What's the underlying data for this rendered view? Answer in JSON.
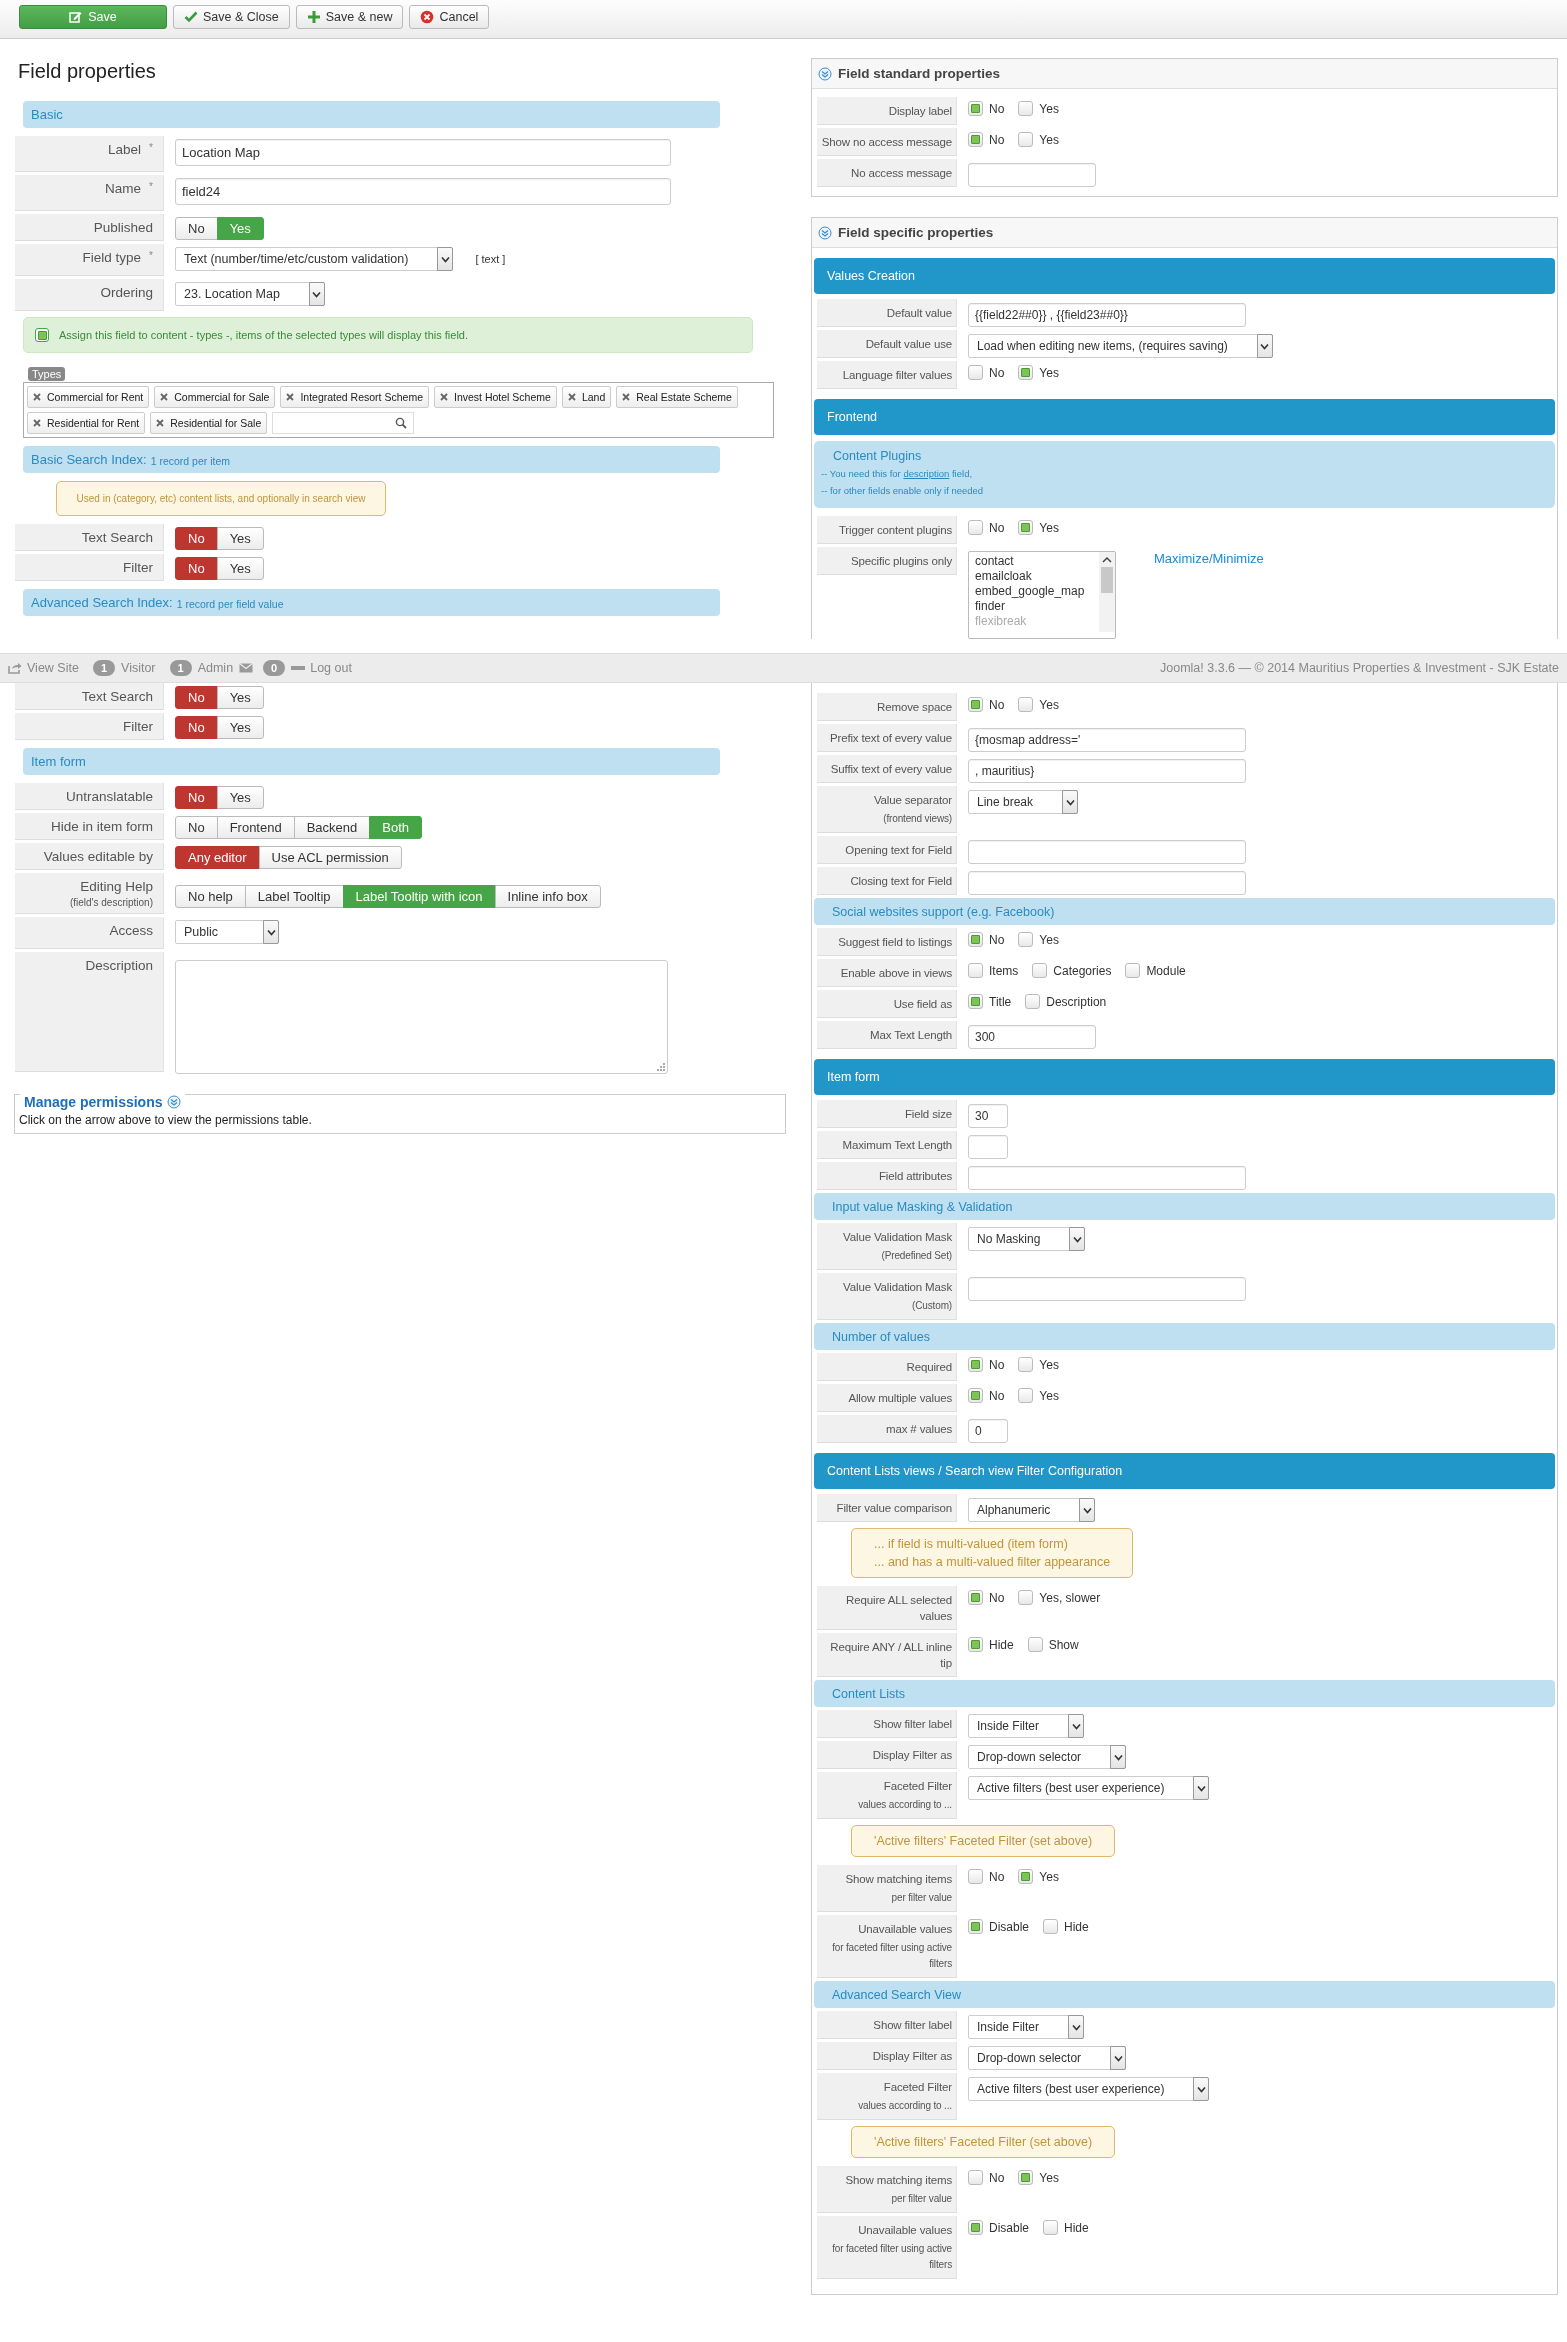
{
  "toolbar": {
    "buttons": [
      {
        "kind": "save",
        "label": "Save"
      },
      {
        "kind": "save_close",
        "label": "Save & Close"
      },
      {
        "kind": "save_new",
        "label": "Save & new"
      },
      {
        "kind": "cancel",
        "label": "Cancel"
      }
    ]
  },
  "page_title": "Field properties",
  "left_top": [
    {
      "kind": "header",
      "title": "Basic"
    },
    {
      "kind": "text",
      "label": "Label",
      "required_mark": "*",
      "value": "Location Map"
    },
    {
      "kind": "text",
      "label": "Name",
      "required_mark": "*",
      "value": "field24"
    },
    {
      "kind": "toggle",
      "label": "Published",
      "color": "#46a546",
      "options": [
        {
          "label": "No",
          "selected": false
        },
        {
          "label": "Yes",
          "selected": true
        }
      ]
    },
    {
      "kind": "select",
      "label": "Field type",
      "required_mark": "*",
      "value": "Text (number/time/etc/custom validation)",
      "suffix": "[ text ]"
    },
    {
      "kind": "select",
      "label": "Ordering",
      "value": "23. Location Map"
    },
    {
      "kind": "assign",
      "text": "Assign this field to content - types -, items of the selected types will display this field.",
      "checked": true
    },
    {
      "kind": "types",
      "title": "Types",
      "tags": [
        "Commercial for Rent",
        "Commercial for Sale",
        "Integrated Resort Scheme",
        "Invest Hotel Scheme",
        "Land",
        "Real Estate Scheme",
        "Residential for Rent",
        "Residential for Sale"
      ]
    },
    {
      "kind": "header",
      "title": "Basic Search Index:",
      "note": "1 record per item"
    },
    {
      "kind": "note",
      "text": "Used in (category, etc) content lists, and optionally in search view"
    },
    {
      "kind": "toggle",
      "label": "Text Search",
      "color": "#bd362f",
      "options": [
        {
          "label": "No",
          "selected": true
        },
        {
          "label": "Yes",
          "selected": false
        }
      ]
    },
    {
      "kind": "toggle",
      "label": "Filter",
      "color": "#bd362f",
      "options": [
        {
          "label": "No",
          "selected": true
        },
        {
          "label": "Yes",
          "selected": false
        }
      ]
    },
    {
      "kind": "header",
      "title": "Advanced Search Index:",
      "note": "1 record per field value"
    }
  ],
  "status_bar": {
    "view_site": "View Site",
    "visitors": "1",
    "visitor_label": "Visitor",
    "admins": "1",
    "admin_label": "Admin",
    "messages": "0",
    "logout": "Log out",
    "footer": "Joomla! 3.3.6 — © 2014 Mauritius Properties & Investment - SJK Estate"
  },
  "left_bottom": [
    {
      "kind": "toggle",
      "label": "Text Search",
      "color": "#bd362f",
      "options": [
        {
          "label": "No",
          "selected": true
        },
        {
          "label": "Yes",
          "selected": false
        }
      ]
    },
    {
      "kind": "toggle",
      "label": "Filter",
      "color": "#bd362f",
      "options": [
        {
          "label": "No",
          "selected": true
        },
        {
          "label": "Yes",
          "selected": false
        }
      ]
    },
    {
      "kind": "header",
      "title": "Item form"
    },
    {
      "kind": "toggle",
      "label": "Untranslatable",
      "color": "#bd362f",
      "options": [
        {
          "label": "No",
          "selected": true
        },
        {
          "label": "Yes",
          "selected": false
        }
      ]
    },
    {
      "kind": "toggle",
      "label": "Hide in item form",
      "color": "#46a546",
      "options": [
        {
          "label": "No",
          "selected": false
        },
        {
          "label": "Frontend",
          "selected": false
        },
        {
          "label": "Backend",
          "selected": false
        },
        {
          "label": "Both",
          "selected": true
        }
      ]
    },
    {
      "kind": "toggle",
      "label": "Values editable by",
      "color": "#bd362f",
      "options": [
        {
          "label": "Any editor",
          "selected": true
        },
        {
          "label": "Use ACL permission",
          "selected": false
        }
      ]
    },
    {
      "kind": "toggle",
      "label": "Editing Help",
      "sublabel": "(field's description)",
      "color": "#46a546",
      "options": [
        {
          "label": "No help",
          "selected": false
        },
        {
          "label": "Label Tooltip",
          "selected": false
        },
        {
          "label": "Label Tooltip with icon",
          "selected": true
        },
        {
          "label": "Inline info box",
          "selected": false
        }
      ]
    },
    {
      "kind": "select",
      "label": "Access",
      "value": "Public"
    },
    {
      "kind": "textarea",
      "label": "Description"
    }
  ],
  "manage_permissions": {
    "title": "Manage permissions",
    "text": "Click on the arrow above to view the permissions table."
  },
  "standard_properties": {
    "title": "Field standard properties",
    "rows": [
      {
        "kind": "radio",
        "label": "Display label",
        "options": [
          {
            "label": "No",
            "checked": true
          },
          {
            "label": "Yes",
            "checked": false
          }
        ]
      },
      {
        "kind": "radio",
        "label": "Show no access message",
        "options": [
          {
            "label": "No",
            "checked": true
          },
          {
            "label": "Yes",
            "checked": false
          }
        ]
      },
      {
        "kind": "shorttext",
        "label": "No access message"
      }
    ]
  },
  "specific_properties": {
    "title": "Field specific properties",
    "top": [
      {
        "kind": "band",
        "title": "Values Creation"
      },
      {
        "kind": "text",
        "label": "Default value",
        "value": "{{field22##0}} , {{field23##0}}"
      },
      {
        "kind": "select",
        "label": "Default value use",
        "value": "Load when editing new items, (requires saving)"
      },
      {
        "kind": "radio",
        "label": "Language filter values",
        "options": [
          {
            "label": "No",
            "checked": false
          },
          {
            "label": "Yes",
            "checked": true
          }
        ]
      },
      {
        "kind": "band",
        "title": "Frontend"
      },
      {
        "kind": "info",
        "title": "Content Plugins",
        "lines": [
          {
            "before": "-- You need this for ",
            "link": "description",
            "after": " field,"
          },
          {
            "before": "-- for other fields enable only if needed"
          }
        ]
      },
      {
        "kind": "radio",
        "label": "Trigger content plugins",
        "options": [
          {
            "label": "No",
            "checked": false
          },
          {
            "label": "Yes",
            "checked": true
          }
        ]
      },
      {
        "kind": "listbox",
        "label": "Specific plugins only",
        "items": [
          "contact",
          "emailcloak",
          "embed_google_map",
          "finder",
          "flexibreak"
        ],
        "link": "Maximize/Minimize"
      }
    ],
    "bottom": [
      {
        "kind": "radio",
        "label": "Remove space",
        "options": [
          {
            "label": "No",
            "checked": true
          },
          {
            "label": "Yes",
            "checked": false
          }
        ]
      },
      {
        "kind": "text",
        "label": "Prefix text of every value",
        "value": "{mosmap address='"
      },
      {
        "kind": "text",
        "label": "Suffix text of every value",
        "value": ", mauritius}"
      },
      {
        "kind": "select",
        "label": "Value separator",
        "sublabel": "(frontend views)",
        "value": "Line break"
      },
      {
        "kind": "text",
        "label": "Opening text for Field"
      },
      {
        "kind": "text",
        "label": "Closing text for Field"
      },
      {
        "kind": "header",
        "title": "Social websites support (e.g. Facebook)"
      },
      {
        "kind": "radio",
        "label": "Suggest field to listings",
        "options": [
          {
            "label": "No",
            "checked": true
          },
          {
            "label": "Yes",
            "checked": false
          }
        ]
      },
      {
        "kind": "radio",
        "label": "Enable above in views",
        "options": [
          {
            "label": "Items",
            "checked": false
          },
          {
            "label": "Categories",
            "checked": false
          },
          {
            "label": "Module",
            "checked": false
          }
        ]
      },
      {
        "kind": "radio",
        "label": "Use field as",
        "options": [
          {
            "label": "Title",
            "checked": true
          },
          {
            "label": "Description",
            "checked": false
          }
        ]
      },
      {
        "kind": "shorttext",
        "label": "Max Text Length",
        "value": "300"
      },
      {
        "kind": "band",
        "title": "Item form"
      },
      {
        "kind": "numtext",
        "label": "Field size",
        "value": "30"
      },
      {
        "kind": "numtext",
        "label": "Maximum Text Length"
      },
      {
        "kind": "text",
        "label": "Field attributes"
      },
      {
        "kind": "header",
        "title": "Input value Masking & Validation"
      },
      {
        "kind": "select",
        "label": "Value Validation Mask",
        "sublabel": "(Predefined Set)",
        "value": "No Masking"
      },
      {
        "kind": "text",
        "label": "Value Validation Mask",
        "sublabel": "(Custom)"
      },
      {
        "kind": "header",
        "title": "Number of values"
      },
      {
        "kind": "radio",
        "label": "Required",
        "options": [
          {
            "label": "No",
            "checked": true
          },
          {
            "label": "Yes",
            "checked": false
          }
        ]
      },
      {
        "kind": "radio",
        "label": "Allow multiple values",
        "options": [
          {
            "label": "No",
            "checked": true
          },
          {
            "label": "Yes",
            "checked": false
          }
        ]
      },
      {
        "kind": "numtext",
        "label": "max # values",
        "value": "0"
      },
      {
        "kind": "band",
        "title": "Content Lists views / Search view Filter Configuration"
      },
      {
        "kind": "select",
        "label": "Filter value comparison",
        "value": "Alphanumeric"
      },
      {
        "kind": "note",
        "text": "... if field is multi-valued (item form)\n... and has a multi-valued filter appearance"
      },
      {
        "kind": "radio",
        "label": "Require ALL selected values",
        "options": [
          {
            "label": "No",
            "checked": true
          },
          {
            "label": "Yes, slower",
            "checked": false
          }
        ]
      },
      {
        "kind": "radio",
        "label": "Require ANY / ALL inline tip",
        "options": [
          {
            "label": "Hide",
            "checked": true
          },
          {
            "label": "Show",
            "checked": false
          }
        ]
      },
      {
        "kind": "header",
        "title": "Content Lists"
      },
      {
        "kind": "select",
        "label": "Show filter label",
        "value": "Inside Filter"
      },
      {
        "kind": "select",
        "label": "Display Filter as",
        "value": "Drop-down selector"
      },
      {
        "kind": "select",
        "label": "Faceted Filter",
        "sublabel": "values according to ...",
        "value": "Active filters (best user experience)"
      },
      {
        "kind": "note",
        "text": "'Active filters' Faceted Filter (set above)"
      },
      {
        "kind": "radio",
        "label": "Show matching items",
        "sublabel": "per filter value",
        "options": [
          {
            "label": "No",
            "checked": false
          },
          {
            "label": "Yes",
            "checked": true
          }
        ]
      },
      {
        "kind": "radio",
        "label": "Unavailable values",
        "sublabel": "for faceted filter using active filters",
        "options": [
          {
            "label": "Disable",
            "checked": true
          },
          {
            "label": "Hide",
            "checked": false
          }
        ]
      },
      {
        "kind": "header",
        "title": "Advanced Search View"
      },
      {
        "kind": "select",
        "label": "Show filter label",
        "value": "Inside Filter"
      },
      {
        "kind": "select",
        "label": "Display Filter as",
        "value": "Drop-down selector"
      },
      {
        "kind": "select",
        "label": "Faceted Filter",
        "sublabel": "values according to ...",
        "value": "Active filters (best user experience)"
      },
      {
        "kind": "note",
        "text": "'Active filters' Faceted Filter (set above)"
      },
      {
        "kind": "radio",
        "label": "Show matching items",
        "sublabel": "per filter value",
        "options": [
          {
            "label": "No",
            "checked": false
          },
          {
            "label": "Yes",
            "checked": true
          }
        ]
      },
      {
        "kind": "radio",
        "label": "Unavailable values",
        "sublabel": "for faceted filter using active filters",
        "options": [
          {
            "label": "Disable",
            "checked": true
          },
          {
            "label": "Hide",
            "checked": false
          }
        ]
      }
    ]
  }
}
